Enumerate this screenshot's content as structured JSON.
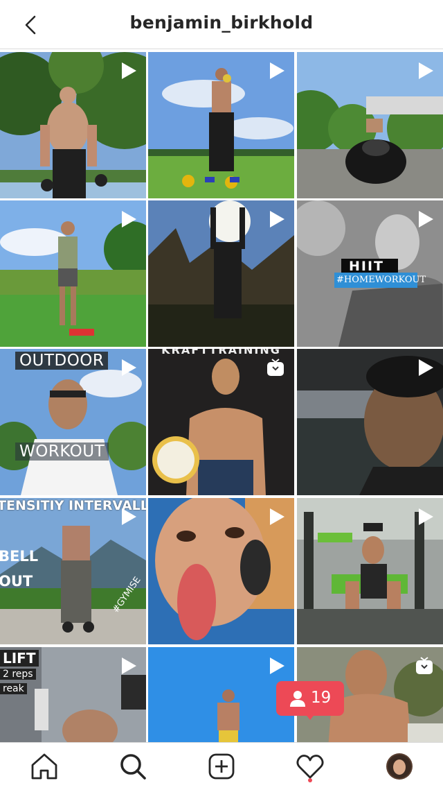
{
  "header": {
    "username": "benjamin_birkhold"
  },
  "posts": [
    {
      "type": "video"
    },
    {
      "type": "video"
    },
    {
      "type": "video"
    },
    {
      "type": "video"
    },
    {
      "type": "video"
    },
    {
      "type": "video",
      "overlay_text": [
        "HIIT",
        "#HOMEWORKOUT"
      ]
    },
    {
      "type": "video",
      "overlay_text": [
        "OUTDOOR",
        "WORKOUT"
      ]
    },
    {
      "type": "igtv",
      "overlay_text": [
        "KRAFTTRAINING"
      ]
    },
    {
      "type": "video"
    },
    {
      "type": "video",
      "overlay_text": [
        "TENSITIY INTERVALL TR",
        "BELL",
        "OUT",
        "#GYMISE"
      ]
    },
    {
      "type": "video"
    },
    {
      "type": "video"
    },
    {
      "type": "video",
      "overlay_text": [
        "LIFT",
        "2 reps",
        "reak"
      ]
    },
    {
      "type": "video"
    },
    {
      "type": "igtv"
    }
  ],
  "notification": {
    "icon": "person-icon",
    "count": "19"
  },
  "tabbar": {
    "items": [
      "home-icon",
      "search-icon",
      "add-post-icon",
      "activity-heart-icon",
      "profile-avatar"
    ]
  },
  "colors": {
    "accent": "#ed4956",
    "text": "#262626",
    "divider": "#dbdbdb"
  }
}
